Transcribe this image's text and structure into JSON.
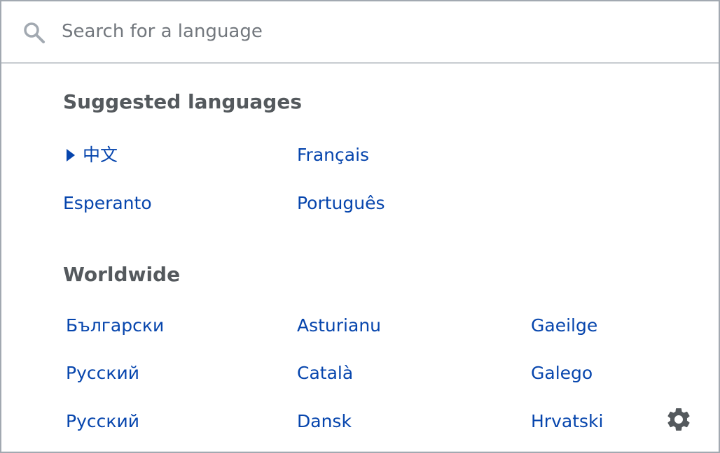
{
  "search": {
    "placeholder": "Search for a language",
    "icon": "search-icon"
  },
  "suggested": {
    "title": "Suggested languages",
    "languages": [
      "中文",
      "Français",
      "Esperanto",
      "Português"
    ],
    "selected": "中文"
  },
  "worldwide": {
    "title": "Worldwide",
    "languages": [
      "Български",
      "Asturianu",
      "Gaeilge",
      "Русский",
      "Català",
      "Galego",
      "Русский",
      "Dansk",
      "Hrvatski"
    ]
  },
  "settings": {
    "icon": "gear-icon"
  },
  "colors": {
    "link": "#0645ad",
    "heading": "#54595d",
    "placeholder": "#72777d",
    "border": "#a2a9b1",
    "divider": "#c8ccd1",
    "icon": "#a2a9b1",
    "gear": "#54595d"
  }
}
